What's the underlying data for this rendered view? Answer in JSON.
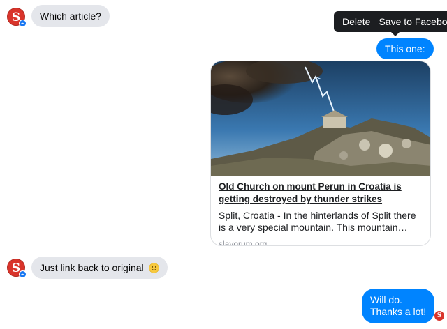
{
  "conversation": {
    "messages": [
      {
        "sender": "them",
        "text": "Which article?"
      },
      {
        "sender": "me",
        "text": "This one:"
      },
      {
        "sender": "them",
        "text": "Just link back to original",
        "emoji": "slightly-smiling-face"
      },
      {
        "sender": "me",
        "line1": "Will do.",
        "line2": "Thanks a lot!"
      }
    ],
    "contact": {
      "avatar_letter": "S",
      "avatar_color": "#d9342b"
    }
  },
  "tooltip": {
    "delete_label": "Delete",
    "save_label": "Save to Facebook"
  },
  "link_preview": {
    "title": "Old Church on mount Perun in Croatia is getting destroyed by thunder strikes",
    "description": "Split, Croatia - In the hinterlands of Split there is a very special mountain.  This mountain bears...",
    "domain": "slavorum.org"
  },
  "colors": {
    "outgoing_bubble": "#0084ff",
    "incoming_bubble": "#e4e6eb",
    "tooltip_bg": "#1c1e21"
  }
}
